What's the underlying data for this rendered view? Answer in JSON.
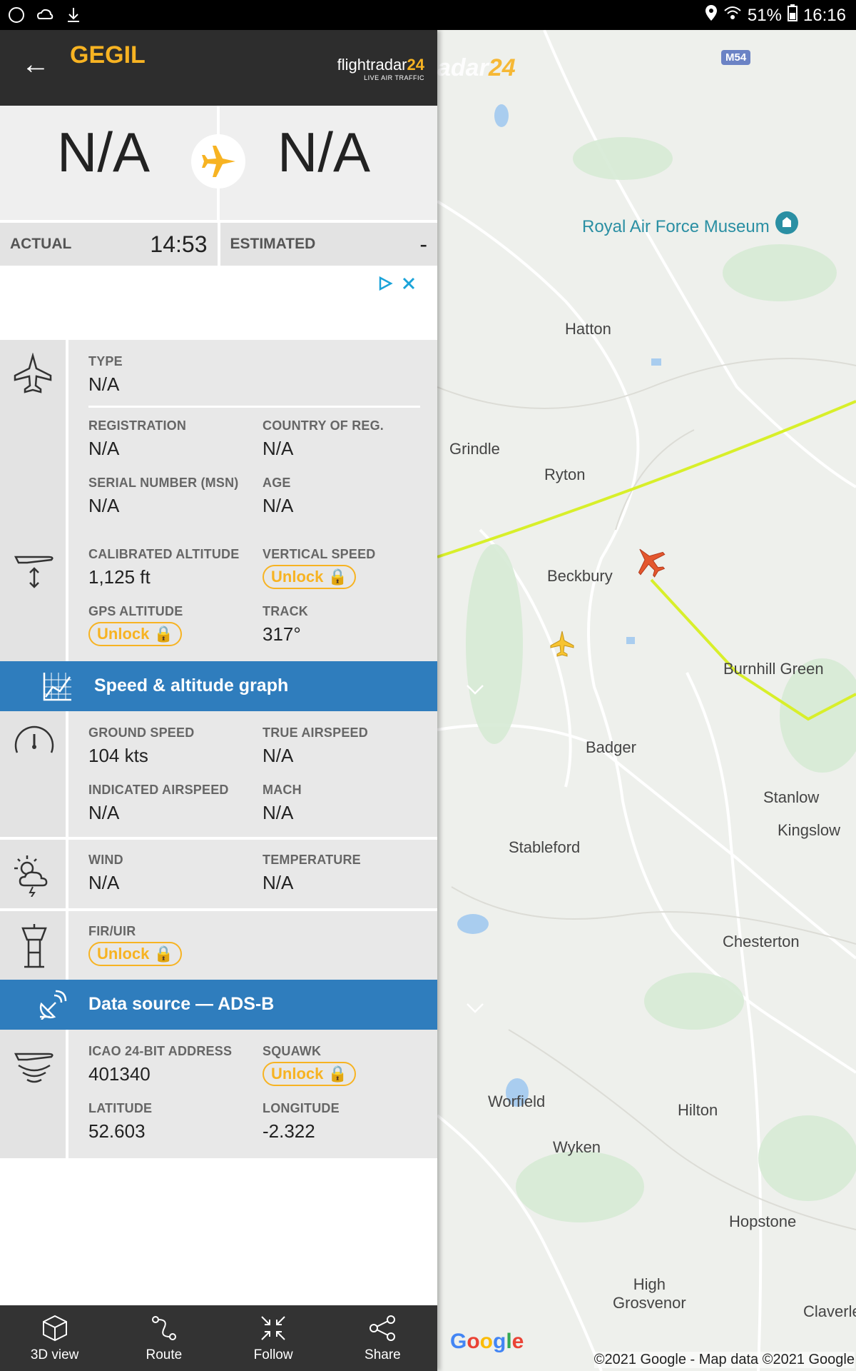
{
  "status_bar": {
    "battery": "51%",
    "time": "16:16"
  },
  "header": {
    "back_label": "←",
    "flight": "GEGIL",
    "logo_main": "flightradar",
    "logo_num": "24",
    "logo_sub": "LIVE AIR TRAFFIC"
  },
  "route": {
    "origin": "N/A",
    "destination": "N/A"
  },
  "times": {
    "actual_label": "ACTUAL",
    "actual_value": "14:53",
    "estimated_label": "ESTIMATED",
    "estimated_value": "-"
  },
  "aircraft": {
    "type_label": "TYPE",
    "type_value": "N/A",
    "registration_label": "REGISTRATION",
    "registration_value": "N/A",
    "country_label": "COUNTRY OF REG.",
    "country_value": "N/A",
    "serial_label": "SERIAL NUMBER (MSN)",
    "serial_value": "N/A",
    "age_label": "AGE",
    "age_value": "N/A"
  },
  "altitude": {
    "calibrated_label": "CALIBRATED ALTITUDE",
    "calibrated_value": "1,125 ft",
    "vertical_label": "VERTICAL SPEED",
    "vertical_value": "Unlock",
    "gps_label": "GPS ALTITUDE",
    "gps_value": "Unlock",
    "track_label": "TRACK",
    "track_value": "317°"
  },
  "speed_graph_bar": {
    "title": "Speed & altitude graph"
  },
  "speed": {
    "ground_label": "GROUND SPEED",
    "ground_value": "104 kts",
    "true_label": "TRUE AIRSPEED",
    "true_value": "N/A",
    "indicated_label": "INDICATED AIRSPEED",
    "indicated_value": "N/A",
    "mach_label": "MACH",
    "mach_value": "N/A"
  },
  "weather": {
    "wind_label": "WIND",
    "wind_value": "N/A",
    "temp_label": "TEMPERATURE",
    "temp_value": "N/A"
  },
  "fir": {
    "label": "FIR/UIR",
    "value": "Unlock"
  },
  "data_source_bar": {
    "title": "Data source — ADS-B"
  },
  "source": {
    "icao_label": "ICAO 24-BIT ADDRESS",
    "icao_value": "401340",
    "squawk_label": "SQUAWK",
    "squawk_value": "Unlock",
    "lat_label": "LATITUDE",
    "lat_value": "52.603",
    "lon_label": "LONGITUDE",
    "lon_value": "-2.322"
  },
  "bottom_nav": [
    {
      "label": "3D view"
    },
    {
      "label": "Route"
    },
    {
      "label": "Follow"
    },
    {
      "label": "Share"
    }
  ],
  "map": {
    "logo_partial": "adar",
    "logo_num": "24",
    "road_badge": "M54",
    "places": [
      "Royal Air Force Museum",
      "Hatton",
      "Grindle",
      "Ryton",
      "Beckbury",
      "Burnhill Green",
      "Badger",
      "Stanlow",
      "Kingslow",
      "Stableford",
      "Chesterton",
      "Worfield",
      "Hilton",
      "Wyken",
      "Hopstone",
      "High\nGrosvenor",
      "Claverle"
    ],
    "google": "Google",
    "copyright": "©2021 Google - Map data ©2021 Google"
  },
  "colors": {
    "accent": "#f7b322",
    "blue_bar": "#2f7dbd",
    "header_bg": "#2d2d2d",
    "track_line": "#d8ef2a",
    "aircraft": "#e4572e"
  }
}
